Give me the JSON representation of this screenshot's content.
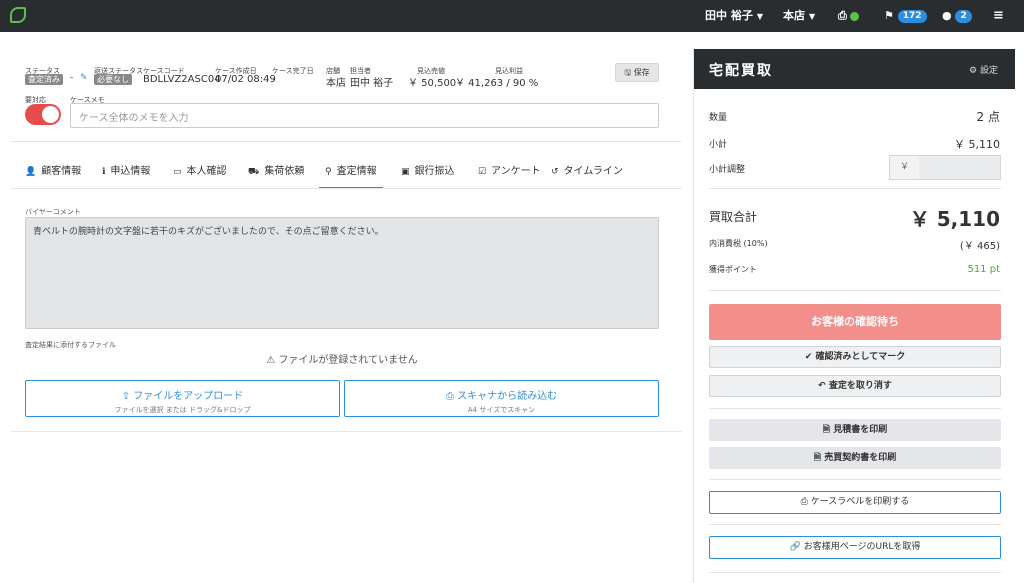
{
  "topbar": {
    "user": "田中 裕子",
    "store": "本店",
    "printer_icon": "printer-icon",
    "flag_count": "172",
    "chat_count": "2"
  },
  "case": {
    "status_label": "ステータス",
    "status_value": "査定済み",
    "dash1": "-",
    "return_status_label": "返送ステータス",
    "return_status_value": "必要なし",
    "case_code_label": "ケースコード",
    "case_code_value": "BDLLVZ2ASC04",
    "created_label": "ケース作成日",
    "created_value": "07/02 08:49",
    "completed_label": "ケース完了日",
    "completed_value": "-",
    "store_label": "店舗",
    "store_value": "本店",
    "staff_label": "担当者",
    "staff_value": "田中 裕子",
    "expected_sales_label": "見込売値",
    "expected_sales_value": "￥ 50,500",
    "expected_profit_label": "見込利益",
    "expected_profit_value": "￥ 41,263 / 90 %",
    "save_label": "保存",
    "needs_action_label": "要対応",
    "memo_label": "ケースメモ",
    "memo_placeholder": "ケース全体のメモを入力"
  },
  "tabs": [
    {
      "icon": "user-icon",
      "label": "顧客情報"
    },
    {
      "icon": "info-icon",
      "label": "申込情報"
    },
    {
      "icon": "id-card-icon",
      "label": "本人確認"
    },
    {
      "icon": "truck-icon",
      "label": "集荷依頼"
    },
    {
      "icon": "search-icon",
      "label": "査定情報"
    },
    {
      "icon": "bank-icon",
      "label": "銀行振込"
    },
    {
      "icon": "survey-icon",
      "label": "アンケート"
    },
    {
      "icon": "history-icon",
      "label": "タイムライン"
    }
  ],
  "assessment": {
    "buyer_comment_label": "バイヤーコメント",
    "buyer_comment": "青ベルトの腕時計の文字盤に若干のキズがございましたので、その点ご留意ください。",
    "files_label": "査定結果に添付するファイル",
    "no_files": "ファイルが登録されていません",
    "upload_label": "ファイルをアップロード",
    "upload_sub": "ファイルを選択 または ドラッグ&ドロップ",
    "scan_label": "スキャナから読み込む",
    "scan_sub": "A4 サイズでスキャン"
  },
  "panel": {
    "title": "宅配買取",
    "settings_label": "設定",
    "quantity_label": "数量",
    "quantity_value": "2 点",
    "subtotal_label": "小計",
    "subtotal_value": "￥ 5,110",
    "adjust_label": "小計調整",
    "adjust_prefix": "￥",
    "total_label": "買取合計",
    "total_value": "￥ 5,110",
    "tax_label": "内消費税 (10%)",
    "tax_value": "(￥ 465)",
    "points_label": "獲得ポイント",
    "points_value": "511 pt",
    "awaiting_label": "お客様の確認待ち",
    "mark_confirmed_label": "確認済みとしてマーク",
    "cancel_assessment_label": "査定を取り消す",
    "print_estimate_label": "見積書を印刷",
    "print_contract_label": "売買契約書を印刷",
    "print_case_label_label": "ケースラベルを印刷する",
    "get_url_label": "お客様用ページのURLを取得"
  },
  "colors": {
    "accent": "#2d8ee0",
    "danger": "#e84b4b",
    "awaiting": "#f38f8b",
    "points": "#5aa63a",
    "topbar": "#2a2d30"
  }
}
